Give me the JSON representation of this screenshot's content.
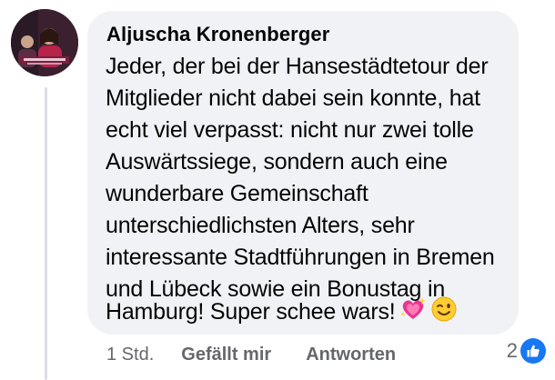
{
  "comment": {
    "author": "Aljuscha Kronenberger",
    "lines": [
      "Jeder, der bei der Hansestädtetour der",
      "Mitglieder nicht dabei sein konnte, hat",
      "echt viel verpasst: nicht nur zwei tolle",
      "Auswärtssiege, sondern auch eine",
      "wunderbare Gemeinschaft",
      "unterschiedlichsten Alters, sehr",
      "interessante Stadtführungen in Bremen",
      "und Lübeck sowie ein Bonustag in",
      "Hamburg! Super schee wars!"
    ],
    "emojis": [
      "sparkling-heart-icon",
      "winking-face-icon"
    ]
  },
  "actions": {
    "timestamp": "1 Std.",
    "like_label": "Gefällt mir",
    "reply_label": "Antworten"
  },
  "reactions": {
    "count": "2",
    "icon": "thumbs-up-icon"
  },
  "colors": {
    "bubble": "#f0f2f5",
    "text": "#050505",
    "secondary": "#65676b",
    "like_blue": "#1877f2"
  }
}
